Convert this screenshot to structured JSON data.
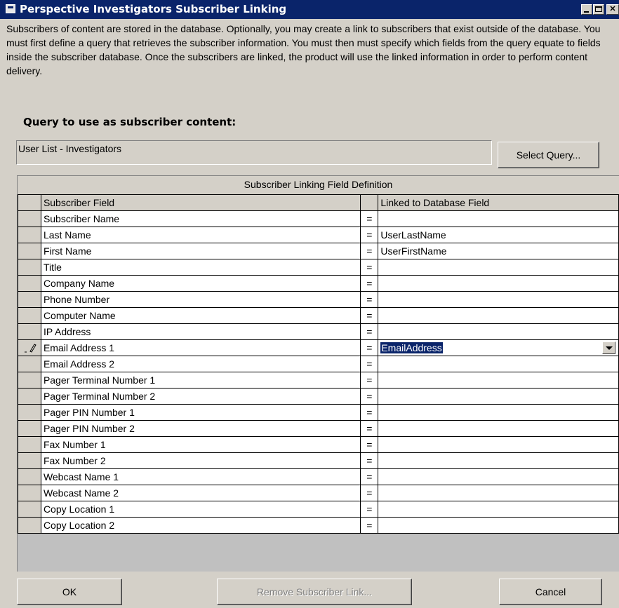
{
  "window": {
    "title": "Perspective Investigators Subscriber Linking"
  },
  "description": "Subscribers of content are stored in the database. Optionally, you may create a link to subscribers that exist outside of the database. You must first define a query that retrieves the subscriber information. You must then must specify which fields from the query equate to fields inside the subscriber database. Once the subscribers are linked, the product will use the linked information in order to perform content delivery.",
  "query": {
    "heading": "Query to use as subscriber content:",
    "value": "User List - Investigators",
    "select_button": "Select Query..."
  },
  "grid": {
    "caption": "Subscriber Linking Field Definition",
    "col_subscriber_field": "Subscriber Field",
    "col_linked_field": "Linked to Database Field",
    "rows": [
      {
        "field": "Subscriber Name",
        "eq": "=",
        "linked": ""
      },
      {
        "field": "Last Name",
        "eq": "=",
        "linked": "UserLastName"
      },
      {
        "field": "First Name",
        "eq": "=",
        "linked": "UserFirstName"
      },
      {
        "field": "Title",
        "eq": "=",
        "linked": ""
      },
      {
        "field": "Company Name",
        "eq": "=",
        "linked": ""
      },
      {
        "field": "Phone Number",
        "eq": "=",
        "linked": ""
      },
      {
        "field": "Computer Name",
        "eq": "=",
        "linked": ""
      },
      {
        "field": "IP Address",
        "eq": "=",
        "linked": ""
      },
      {
        "field": "Email Address 1",
        "eq": "=",
        "linked": "EmailAddress",
        "editing": true
      },
      {
        "field": "Email Address 2",
        "eq": "=",
        "linked": ""
      },
      {
        "field": "Pager Terminal Number 1",
        "eq": "=",
        "linked": ""
      },
      {
        "field": "Pager Terminal Number 2",
        "eq": "=",
        "linked": ""
      },
      {
        "field": "Pager PIN Number 1",
        "eq": "=",
        "linked": ""
      },
      {
        "field": "Pager PIN Number 2",
        "eq": "=",
        "linked": ""
      },
      {
        "field": "Fax Number 1",
        "eq": "=",
        "linked": ""
      },
      {
        "field": "Fax Number 2",
        "eq": "=",
        "linked": ""
      },
      {
        "field": "Webcast Name 1",
        "eq": "=",
        "linked": ""
      },
      {
        "field": "Webcast Name 2",
        "eq": "=",
        "linked": ""
      },
      {
        "field": "Copy Location 1",
        "eq": "=",
        "linked": ""
      },
      {
        "field": "Copy Location 2",
        "eq": "=",
        "linked": ""
      }
    ]
  },
  "buttons": {
    "ok": "OK",
    "remove": "Remove Subscriber Link...",
    "cancel": "Cancel"
  },
  "icons": {
    "window_icon": "app-window-icon",
    "row_indicator": "pencil-icon",
    "dropdown": "chevron-down-icon"
  }
}
